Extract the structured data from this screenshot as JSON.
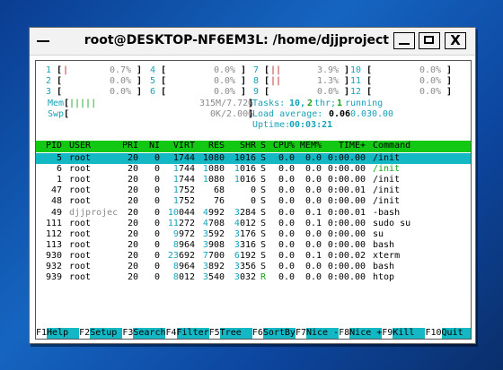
{
  "window": {
    "title": "root@DESKTOP-NF6EM3L: /home/djjproject",
    "minimize_label": "",
    "close_glyph": "X"
  },
  "meters": {
    "cpus": [
      {
        "num": "1",
        "bar": "|",
        "pct": "0.7%"
      },
      {
        "num": "2",
        "bar": "",
        "pct": "0.0%"
      },
      {
        "num": "3",
        "bar": "",
        "pct": "0.0%"
      },
      {
        "num": "4",
        "bar": "",
        "pct": "0.0%"
      },
      {
        "num": "5",
        "bar": "",
        "pct": "0.0%"
      },
      {
        "num": "6",
        "bar": "",
        "pct": "0.0%"
      },
      {
        "num": "7",
        "bar": "||",
        "pct": "3.9%"
      },
      {
        "num": "8",
        "bar": "||",
        "pct": "1.3%"
      },
      {
        "num": "9",
        "bar": "",
        "pct": "0.0%"
      },
      {
        "num": "10",
        "bar": "",
        "pct": "0.0%"
      },
      {
        "num": "11",
        "bar": "",
        "pct": "0.0%"
      },
      {
        "num": "12",
        "bar": "",
        "pct": "0.0%"
      }
    ],
    "mem_label": "Mem",
    "mem_bar": "|||||",
    "mem_value": "315M/7.72G",
    "swp_label": "Swp",
    "swp_value": "0K/2.00G",
    "tasks_label": "Tasks:",
    "tasks_count": "10,",
    "threads_count": "2",
    "thr_label": "thr;",
    "running_count": "1",
    "running_label": "running",
    "load_label": "Load average:",
    "load1": "0.06",
    "load5": "0.03",
    "load15": "0.00",
    "uptime_label": "Uptime:",
    "uptime_value": "00:03:21"
  },
  "table": {
    "headers": [
      "PID",
      "USER",
      "PRI",
      "NI",
      "VIRT",
      "RES",
      "SHR",
      "S",
      "CPU%",
      "MEM%",
      "TIME+",
      "Command"
    ],
    "rows": [
      [
        "5",
        "root",
        "20",
        "0",
        "1744",
        "1080",
        "1016",
        "S",
        "0.0",
        "0.0",
        "0:00.00",
        "/init"
      ],
      [
        "6",
        "root",
        "20",
        "0",
        "1744",
        "1080",
        "1016",
        "S",
        "0.0",
        "0.0",
        "0:00.00",
        "/init"
      ],
      [
        "1",
        "root",
        "20",
        "0",
        "1744",
        "1080",
        "1016",
        "S",
        "0.0",
        "0.0",
        "0:00.00",
        "/init"
      ],
      [
        "47",
        "root",
        "20",
        "0",
        "1752",
        "68",
        "0",
        "S",
        "0.0",
        "0.0",
        "0:00.01",
        "/init"
      ],
      [
        "48",
        "root",
        "20",
        "0",
        "1752",
        "76",
        "0",
        "S",
        "0.0",
        "0.0",
        "0:00.00",
        "/init"
      ],
      [
        "49",
        "djjprojec",
        "20",
        "0",
        "10044",
        "4992",
        "3284",
        "S",
        "0.0",
        "0.1",
        "0:00.01",
        "-bash"
      ],
      [
        "111",
        "root",
        "20",
        "0",
        "11272",
        "4708",
        "4012",
        "S",
        "0.0",
        "0.1",
        "0:00.00",
        "sudo su"
      ],
      [
        "112",
        "root",
        "20",
        "0",
        "9972",
        "3592",
        "3176",
        "S",
        "0.0",
        "0.0",
        "0:00.00",
        "su"
      ],
      [
        "113",
        "root",
        "20",
        "0",
        "8964",
        "3908",
        "3316",
        "S",
        "0.0",
        "0.0",
        "0:00.00",
        "bash"
      ],
      [
        "930",
        "root",
        "20",
        "0",
        "23692",
        "7700",
        "6192",
        "S",
        "0.0",
        "0.1",
        "0:00.02",
        "xterm"
      ],
      [
        "932",
        "root",
        "20",
        "0",
        "8964",
        "3892",
        "3356",
        "S",
        "0.0",
        "0.0",
        "0:00.00",
        "bash"
      ],
      [
        "939",
        "root",
        "20",
        "0",
        "8012",
        "3540",
        "3032",
        "R",
        "0.0",
        "0.0",
        "0:00.00",
        "htop"
      ]
    ]
  },
  "footer": [
    {
      "key": "F1",
      "label": "Help  "
    },
    {
      "key": "F2",
      "label": "Setup "
    },
    {
      "key": "F3",
      "label": "Search"
    },
    {
      "key": "F4",
      "label": "Filter"
    },
    {
      "key": "F5",
      "label": "Tree  "
    },
    {
      "key": "F6",
      "label": "SortBy"
    },
    {
      "key": "F7",
      "label": "Nice -"
    },
    {
      "key": "F8",
      "label": "Nice +"
    },
    {
      "key": "F9",
      "label": "Kill  "
    },
    {
      "key": "F10",
      "label": "Quit  "
    }
  ],
  "colors": {
    "header_bg": "#13c813",
    "selection_bg": "#14b8c4",
    "cyan": "#17a2b8",
    "green": "#15a315",
    "red": "#c21818"
  }
}
